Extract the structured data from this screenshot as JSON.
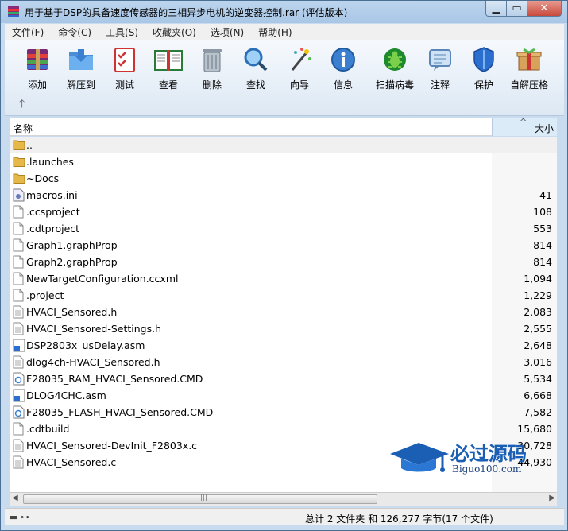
{
  "window": {
    "title": "用于基于DSP的具备速度传感器的三相异步电机的逆变器控制.rar (评估版本)"
  },
  "menu": [
    "文件(F)",
    "命令(C)",
    "工具(S)",
    "收藏夹(O)",
    "选项(N)",
    "帮助(H)"
  ],
  "toolbar": {
    "add": "添加",
    "extract": "解压到",
    "test": "测试",
    "view": "查看",
    "delete": "删除",
    "find": "查找",
    "wizard": "向导",
    "info": "信息",
    "virus": "扫描病毒",
    "comment": "注释",
    "protect": "保护",
    "sfx": "自解压格"
  },
  "list": {
    "header_name": "名称",
    "header_size": "大小",
    "files": [
      {
        "name": "..",
        "size": "",
        "icon": "folder"
      },
      {
        "name": ".launches",
        "size": "",
        "icon": "folder"
      },
      {
        "name": "~Docs",
        "size": "",
        "icon": "folder"
      },
      {
        "name": "macros.ini",
        "size": "41",
        "icon": "config"
      },
      {
        "name": ".ccsproject",
        "size": "108",
        "icon": "file"
      },
      {
        "name": ".cdtproject",
        "size": "553",
        "icon": "file"
      },
      {
        "name": "Graph1.graphProp",
        "size": "814",
        "icon": "file"
      },
      {
        "name": "Graph2.graphProp",
        "size": "814",
        "icon": "file"
      },
      {
        "name": "NewTargetConfiguration.ccxml",
        "size": "1,094",
        "icon": "file"
      },
      {
        "name": ".project",
        "size": "1,229",
        "icon": "file"
      },
      {
        "name": "HVACI_Sensored.h",
        "size": "2,083",
        "icon": "text"
      },
      {
        "name": "HVACI_Sensored-Settings.h",
        "size": "2,555",
        "icon": "text"
      },
      {
        "name": "DSP2803x_usDelay.asm",
        "size": "2,648",
        "icon": "asm"
      },
      {
        "name": "dlog4ch-HVACI_Sensored.h",
        "size": "3,016",
        "icon": "text"
      },
      {
        "name": "F28035_RAM_HVACI_Sensored.CMD",
        "size": "5,534",
        "icon": "cmd"
      },
      {
        "name": "DLOG4CHC.asm",
        "size": "6,668",
        "icon": "asm"
      },
      {
        "name": "F28035_FLASH_HVACI_Sensored.CMD",
        "size": "7,582",
        "icon": "cmd"
      },
      {
        "name": ".cdtbuild",
        "size": "15,680",
        "icon": "file"
      },
      {
        "name": "HVACI_Sensored-DevInit_F2803x.c",
        "size": "30,728",
        "icon": "text"
      },
      {
        "name": "HVACI_Sensored.c",
        "size": "44,930",
        "icon": "text"
      }
    ]
  },
  "status": {
    "summary": "总计 2 文件夹 和 126,277 字节(17 个文件)"
  },
  "watermark": {
    "title": "必过源码",
    "url": "Biguo100.com"
  }
}
